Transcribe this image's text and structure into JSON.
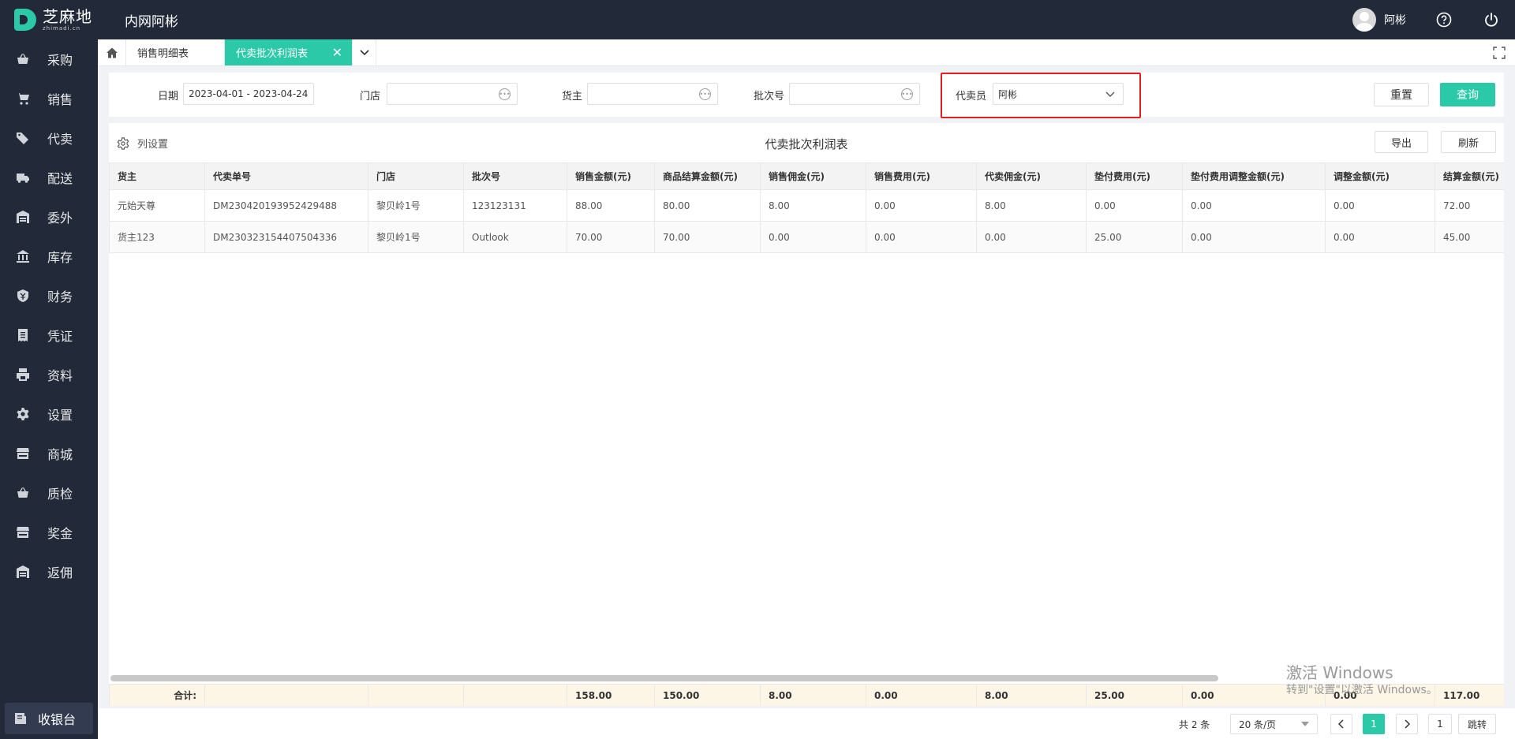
{
  "app": {
    "logo_cn": "芝麻地",
    "logo_en": "zhimadi.cn",
    "org_name": "内网阿彬",
    "user_name": "阿彬"
  },
  "sidebar": {
    "items": [
      {
        "label": "采购",
        "icon": "basket-icon"
      },
      {
        "label": "销售",
        "icon": "cart-icon"
      },
      {
        "label": "代卖",
        "icon": "tag-icon"
      },
      {
        "label": "配送",
        "icon": "truck-icon"
      },
      {
        "label": "委外",
        "icon": "warehouse-icon"
      },
      {
        "label": "库存",
        "icon": "bank-icon"
      },
      {
        "label": "财务",
        "icon": "shield-money-icon"
      },
      {
        "label": "凭证",
        "icon": "receipt-icon"
      },
      {
        "label": "资料",
        "icon": "printer-icon"
      },
      {
        "label": "设置",
        "icon": "gear-icon"
      },
      {
        "label": "商城",
        "icon": "store-icon"
      },
      {
        "label": "质检",
        "icon": "basket-check-icon"
      },
      {
        "label": "奖金",
        "icon": "store-icon"
      },
      {
        "label": "返佣",
        "icon": "warehouse-icon"
      }
    ],
    "cashier_label": "收银台"
  },
  "tabs": {
    "items": [
      {
        "label": "销售明细表",
        "active": false
      },
      {
        "label": "代卖批次利润表",
        "active": true
      }
    ]
  },
  "filters": {
    "date_label": "日期",
    "date_value": "2023-04-01 - 2023-04-24",
    "store_label": "门店",
    "store_value": "",
    "owner_label": "货主",
    "owner_value": "",
    "batch_label": "批次号",
    "batch_value": "",
    "agent_label": "代卖员",
    "agent_value": "阿彬",
    "reset_label": "重置",
    "query_label": "查询"
  },
  "panel": {
    "column_settings_label": "列设置",
    "title": "代卖批次利润表",
    "export_label": "导出",
    "refresh_label": "刷新"
  },
  "table": {
    "headers": [
      "货主",
      "代卖单号",
      "门店",
      "批次号",
      "销售金额(元)",
      "商品结算金额(元)",
      "销售佣金(元)",
      "销售费用(元)",
      "代卖佣金(元)",
      "垫付费用(元)",
      "垫付费用调整金额(元)",
      "调整金额(元)",
      "结算金额(元)"
    ],
    "rows": [
      [
        "元始天尊",
        "DM230420193952429488",
        "黎贝岭1号",
        "123123131",
        "88.00",
        "80.00",
        "8.00",
        "0.00",
        "8.00",
        "0.00",
        "0.00",
        "0.00",
        "72.00"
      ],
      [
        "货主123",
        "DM230323154407504336",
        "黎贝岭1号",
        "Outlook",
        "70.00",
        "70.00",
        "0.00",
        "0.00",
        "0.00",
        "25.00",
        "0.00",
        "0.00",
        "45.00"
      ]
    ],
    "totals": [
      "合计:",
      "",
      "",
      "",
      "158.00",
      "150.00",
      "8.00",
      "0.00",
      "8.00",
      "25.00",
      "0.00",
      "0.00",
      "117.00"
    ]
  },
  "watermark": {
    "line1": "激活 Windows",
    "line2": "转到\"设置\"以激活 Windows。"
  },
  "pagination": {
    "total_text": "共 2 条",
    "page_size": "20 条/页",
    "current_page": "1",
    "jump_value": "1",
    "jump_label": "跳转"
  },
  "colors": {
    "accent": "#2bc9a8",
    "sidebar_bg": "#222a3a",
    "highlight": "#e02020"
  }
}
